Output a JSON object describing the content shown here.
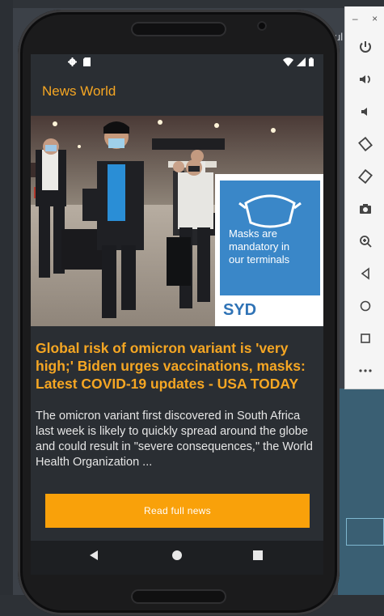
{
  "app": {
    "title": "News World"
  },
  "article": {
    "headline": "Global risk of omicron variant is 'very high;' Biden urges vaccinations, masks: Latest COVID-19 updates - USA TODAY",
    "summary": "The omicron variant first discovered in South Africa last week is likely to quickly spread around the globe and could result in \"severe consequences,\" the World Health Organization ...",
    "button_label": "Read full news"
  },
  "hero_image": {
    "sign_line1": "Masks are",
    "sign_line2": "mandatory in",
    "sign_line3": "our terminals",
    "sign_code": "SYD"
  },
  "host": {
    "fragment_text": "ul"
  },
  "toolbar": {
    "minimize": "–",
    "close": "×",
    "buttons": [
      "power-icon",
      "volume-up-icon",
      "volume-down-icon",
      "rotate-left-icon",
      "rotate-right-icon",
      "camera-icon",
      "zoom-icon",
      "back-icon",
      "home-icon",
      "overview-icon",
      "more-icon"
    ]
  },
  "colors": {
    "accent": "#f5a623",
    "button": "#f9a10a",
    "screen_bg": "#2a2e33"
  }
}
